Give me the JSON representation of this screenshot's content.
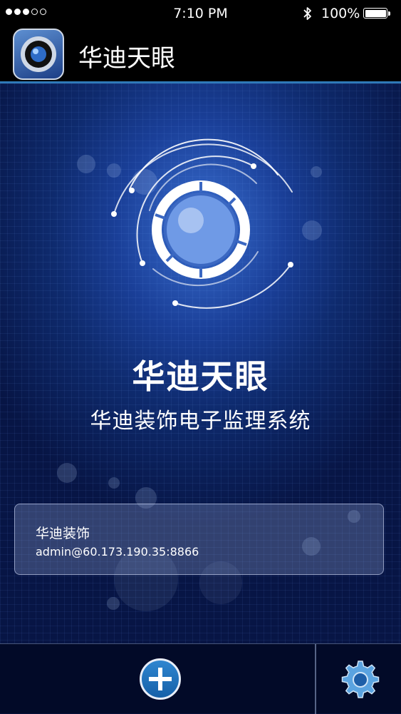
{
  "status_bar": {
    "time": "7:10 PM",
    "battery_percent": "100%",
    "signal_bars": 3,
    "signal_total": 5,
    "bluetooth_icon": "bluetooth-icon",
    "battery_level": 1.0
  },
  "header": {
    "title": "华迪天眼",
    "app_icon": "camera-lens-icon"
  },
  "hero": {
    "logo_icon": "eye-lens-logo-icon",
    "title": "华迪天眼",
    "subtitle": "华迪装饰电子监理系统"
  },
  "device_list": [
    {
      "name": "华迪装饰",
      "address": "admin@60.173.190.35:8866"
    }
  ],
  "bottom_bar": {
    "add_icon": "plus-circle-icon",
    "settings_icon": "gear-icon"
  },
  "colors": {
    "accent": "#2f79b8",
    "background": "#0e2a6d",
    "button_blue": "#1e72bd"
  }
}
